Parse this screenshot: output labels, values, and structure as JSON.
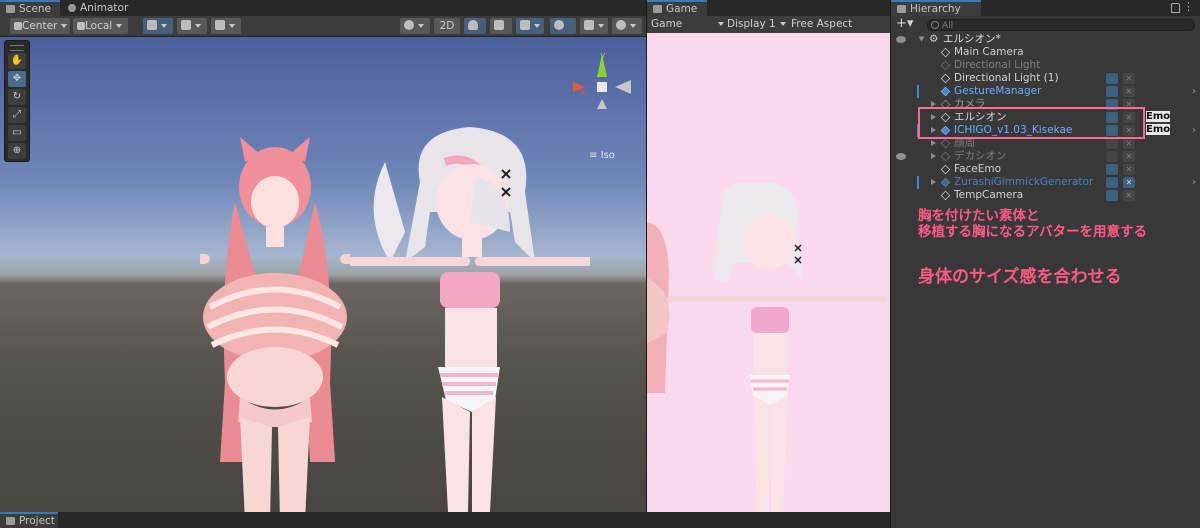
{
  "scene": {
    "tabs": [
      "Scene",
      "Animator"
    ],
    "pivot_mode": "Center",
    "pivot_space": "Local",
    "toolbar_2d": "2D",
    "iso_label": "Iso"
  },
  "game": {
    "tab": "Game",
    "mode": "Game",
    "display": "Display 1",
    "aspect": "Free Aspect"
  },
  "hierarchy": {
    "tab": "Hierarchy",
    "search_placeholder": "All",
    "scene_name": "エルシオン*",
    "items": [
      {
        "label": "Main Camera"
      },
      {
        "label": "Directional Light"
      },
      {
        "label": "Directional Light (1)"
      },
      {
        "label": "GestureManager"
      },
      {
        "label": "カメラ"
      },
      {
        "label": "エルシオン"
      },
      {
        "label": "ICHIGO_v1.03_Kisekae"
      },
      {
        "label": "顔周"
      },
      {
        "label": "デカシオン"
      },
      {
        "label": "FaceEmo"
      },
      {
        "label": "ZurashiGimmickGenerator"
      },
      {
        "label": "TempCamera"
      }
    ],
    "emo_badges": [
      "Emo",
      "Emo"
    ]
  },
  "annotations": {
    "line1": "胸を付けたい素体と",
    "line2": "移植する胸になるアバターを用意する",
    "big": "身体のサイズ感を合わせる"
  },
  "project": {
    "tab": "Project"
  },
  "colors": {
    "annotation": "#ff5a84",
    "selection_frame": "#ff6b95",
    "prefab_blue": "#6aaeff",
    "game_bg": "#fbd9ec"
  }
}
